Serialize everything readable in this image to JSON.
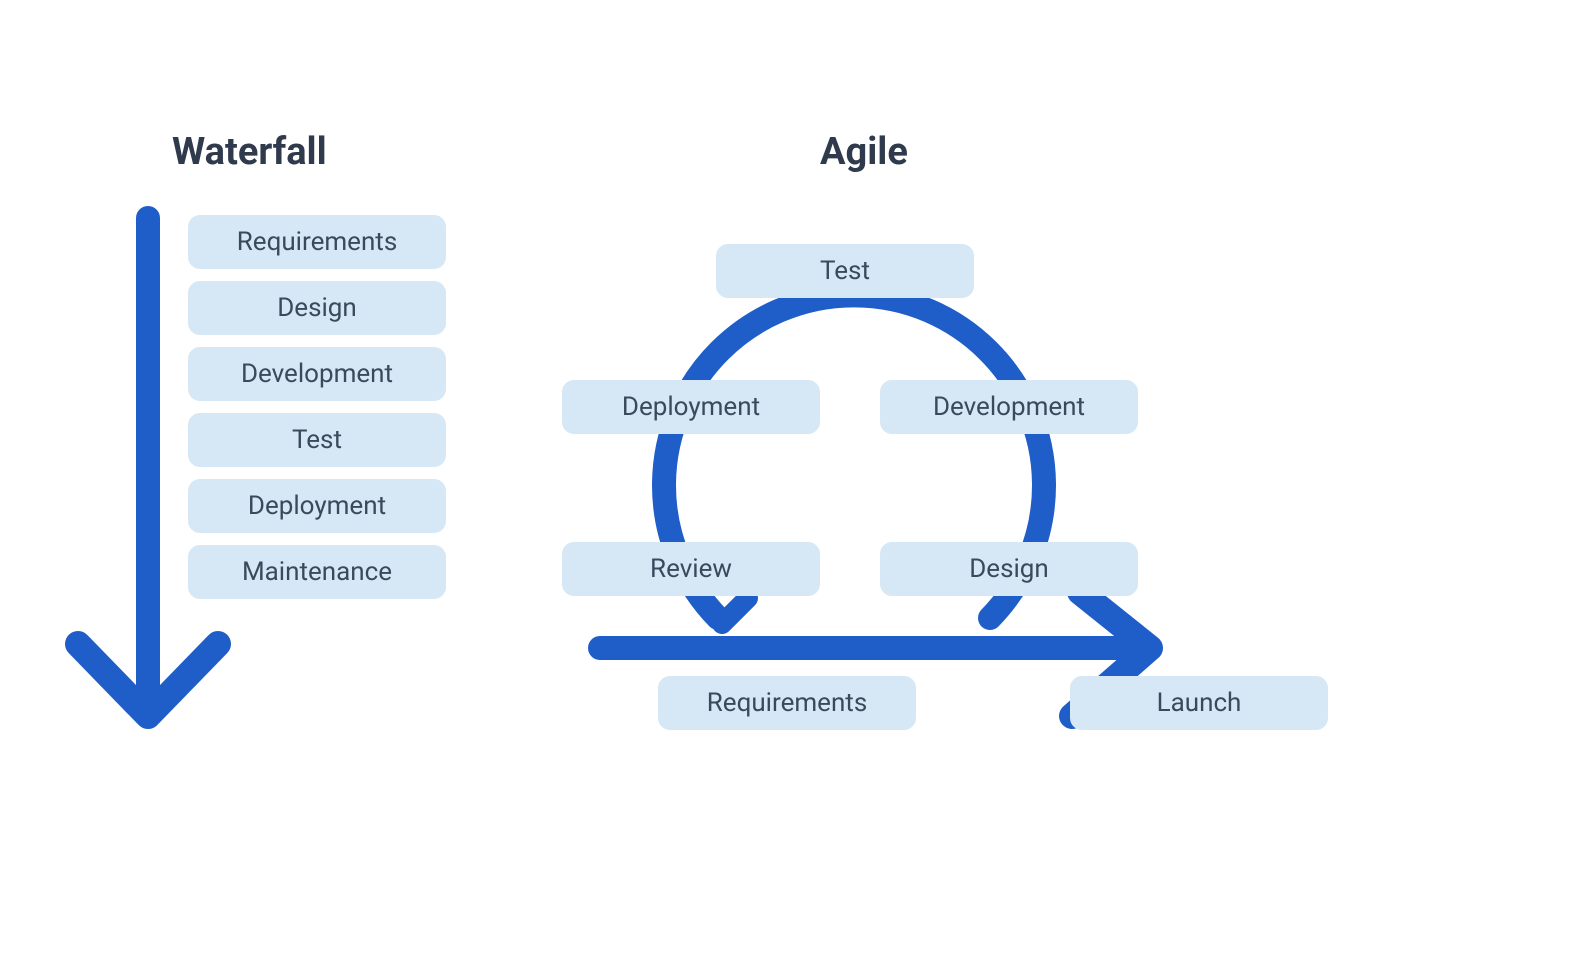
{
  "waterfall": {
    "title": "Waterfall",
    "steps": [
      "Requirements",
      "Design",
      "Development",
      "Test",
      "Deployment",
      "Maintenance"
    ]
  },
  "agile": {
    "title": "Agile",
    "nodes": {
      "test": "Test",
      "deployment": "Deployment",
      "development": "Development",
      "review": "Review",
      "design": "Design",
      "requirements": "Requirements",
      "launch": "Launch"
    }
  },
  "colors": {
    "arrow": "#1F5EC9",
    "arrowLight": "#2E6EDB",
    "pill": "#D6E8F5",
    "text": "#3A4A5C",
    "heading": "#2F3B4C"
  }
}
